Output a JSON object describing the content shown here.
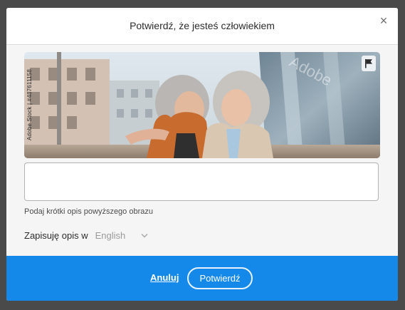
{
  "dialog": {
    "title": "Potwierdź, że jesteś człowiekiem",
    "close_symbol": "×"
  },
  "image": {
    "caption": "Adobe Stock | #487611158",
    "watermark": "Adobe",
    "alt": "Dwie starsze kobiety o siwych włosach śmieją się na ulicy miasta",
    "flag_icon": "flag-icon"
  },
  "description": {
    "value": "",
    "hint": "Podaj krótki opis powyższego obrazu"
  },
  "language": {
    "label": "Zapisuję opis w",
    "selected": "English"
  },
  "footer": {
    "cancel_label": "Anuluj",
    "confirm_label": "Potwierdź"
  },
  "colors": {
    "accent": "#1589ea",
    "backdrop": "#4a4a4a",
    "dialog_bg": "#f5f5f5"
  }
}
